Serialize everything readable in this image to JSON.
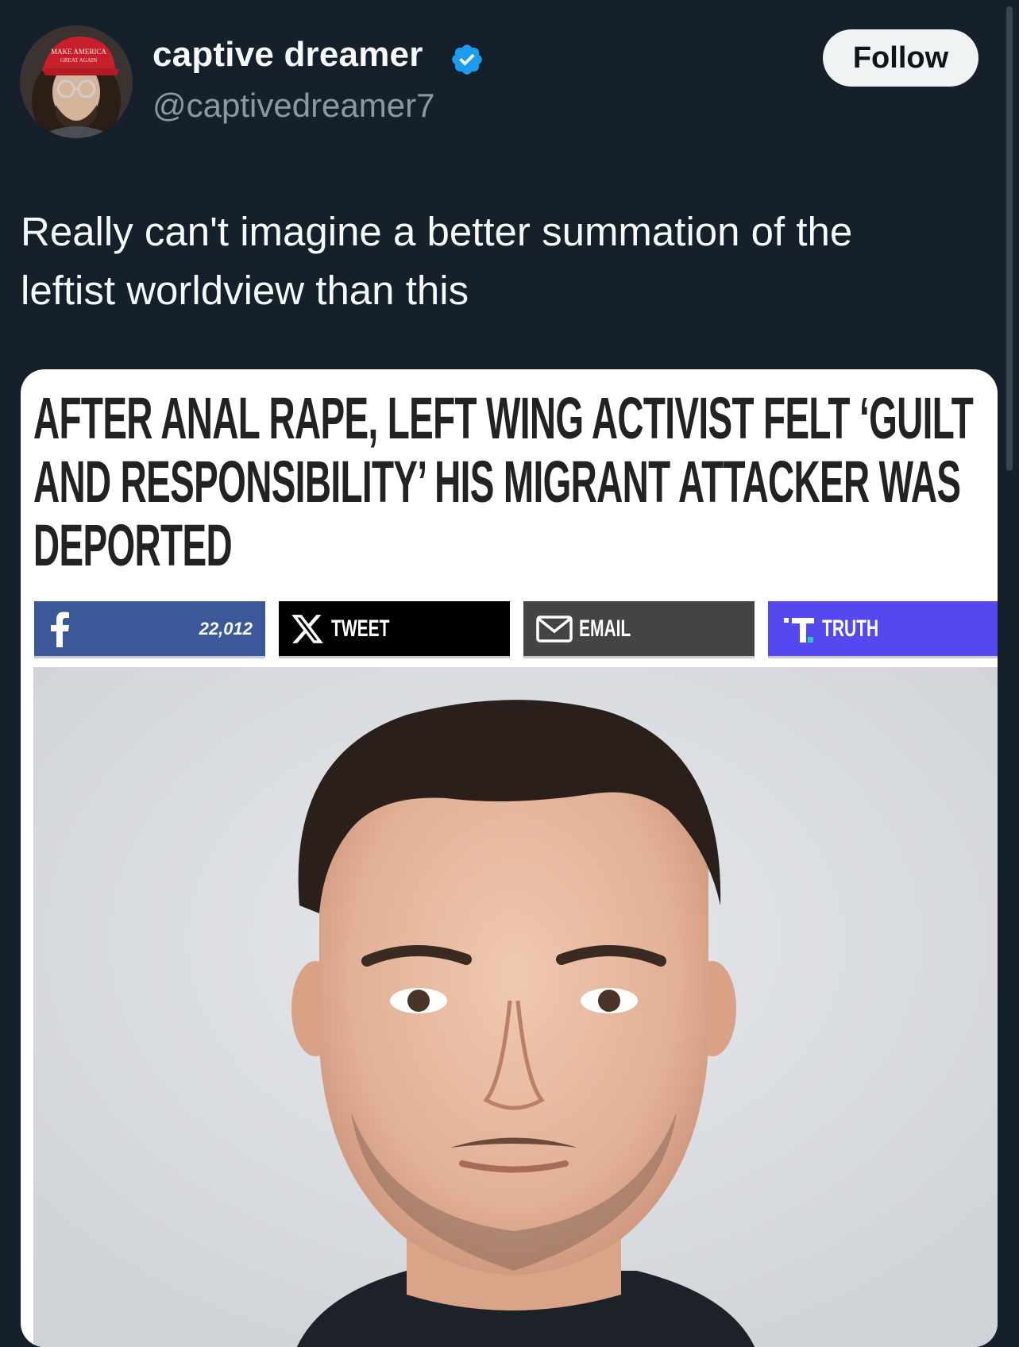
{
  "author": {
    "display_name": "captive dreamer",
    "handle": "@captivedreamer7",
    "avatar": "profile-photo",
    "verified_icon": "verified-badge-icon",
    "verified_color": "#1d9bf0"
  },
  "follow_button": {
    "label": "Follow"
  },
  "tweet": {
    "text": "Really can't imagine a better summation of the leftist worldview than this"
  },
  "card": {
    "headline": "AFTER ANAL RAPE, LEFT WING ACTIVIST FELT ‘GUILT AND RESPONSIBILITY’ HIS MIGRANT ATTACKER WAS DEPORTED",
    "share": {
      "facebook": {
        "icon": "facebook-icon",
        "count": "22,012",
        "color": "#3b5998"
      },
      "tweet": {
        "icon": "x-logo-icon",
        "label": "TWEET",
        "color": "#000000"
      },
      "email": {
        "icon": "envelope-icon",
        "label": "EMAIL",
        "color": "#444444"
      },
      "truth": {
        "icon": "truth-social-icon",
        "label": "TRUTH",
        "color": "#5448ee"
      }
    },
    "image": "portrait-photo"
  },
  "colors": {
    "background": "#15202b",
    "text_primary": "#f7f9f9",
    "text_secondary": "#8b98a5"
  }
}
